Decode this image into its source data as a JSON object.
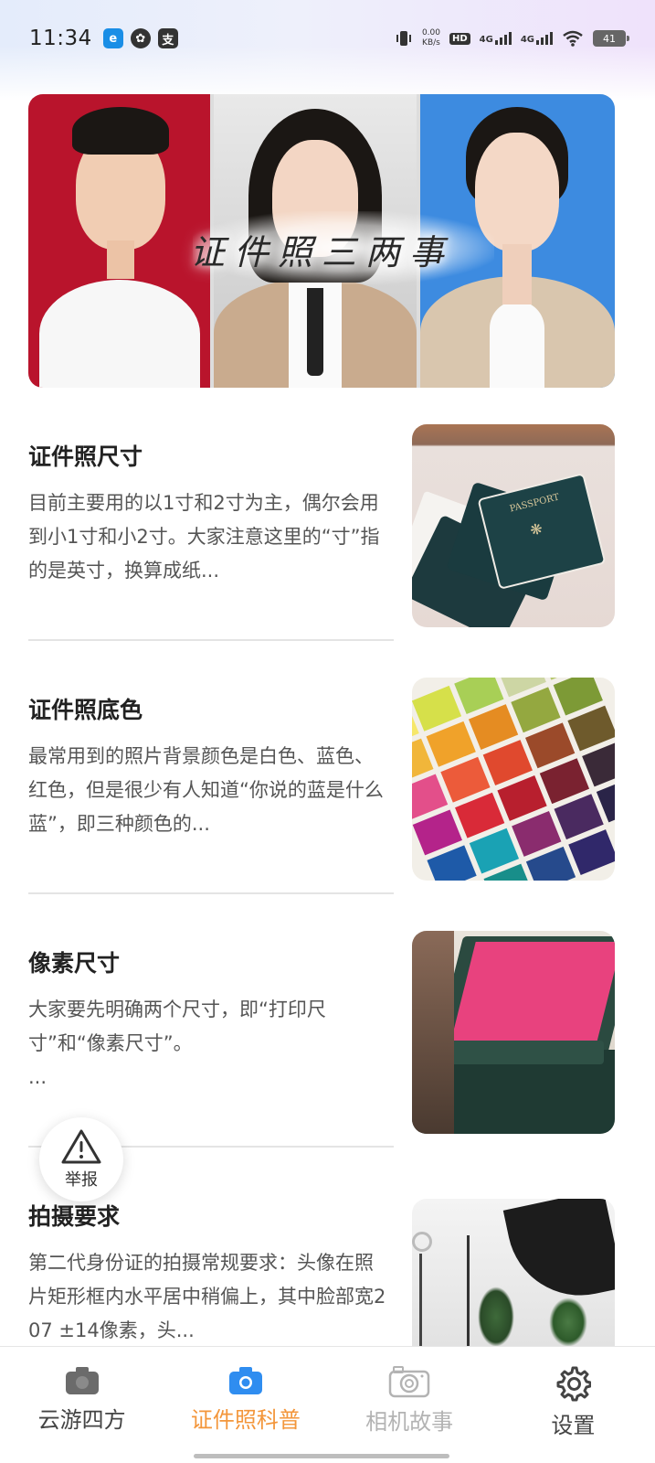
{
  "status_bar": {
    "time": "11:34",
    "net_speed_value": "0.00",
    "net_speed_unit": "KB/s",
    "hd_label": "HD",
    "sim1_label": "4G",
    "sim2_label": "4G",
    "battery": "41"
  },
  "banner": {
    "title": "证件照三两事"
  },
  "articles": [
    {
      "title": "证件照尺寸",
      "desc": "目前主要用的以1寸和2寸为主，偶尔会用到小1寸和小2寸。大家注意这里的“寸”指的是英寸，换算成纸..."
    },
    {
      "title": "证件照底色",
      "desc": "最常用到的照片背景颜色是白色、蓝色、红色，但是很少有人知道“你说的蓝是什么蓝”，即三种颜色的..."
    },
    {
      "title": "像素尺寸",
      "desc": "大家要先明确两个尺寸，即“打印尺寸”和“像素尺寸”。",
      "desc2": "..."
    },
    {
      "title": "拍摄要求",
      "desc": "第二代身份证的拍摄常规要求：头像在照片矩形框内水平居中稍偏上，其中脸部宽207 ±14像素，头..."
    }
  ],
  "report_button": {
    "label": "举报",
    "icon": "warning-triangle-icon"
  },
  "bottom_nav": {
    "items": [
      {
        "label": "云游四方",
        "icon": "camera-icon",
        "state": "inactive"
      },
      {
        "label": "证件照科普",
        "icon": "camera-icon",
        "state": "active"
      },
      {
        "label": "相机故事",
        "icon": "retro-camera-icon",
        "state": "faded"
      },
      {
        "label": "设置",
        "icon": "gear-icon",
        "state": "inactive"
      }
    ]
  },
  "colors": {
    "accent": "#f3963b",
    "active_icon": "#2f8df0",
    "inactive_icon": "#666666",
    "faded": "#b3b3b3"
  }
}
